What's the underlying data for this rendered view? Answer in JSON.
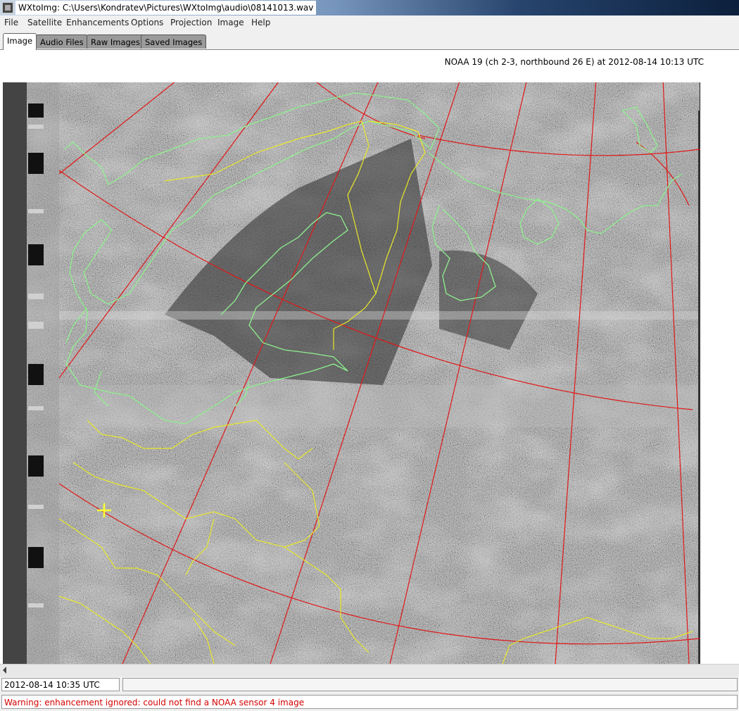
{
  "window": {
    "title": "WXtoImg: C:\\Users\\Kondratev\\Pictures\\WXtoImg\\audio\\08141013.wav"
  },
  "menu": [
    "File",
    "Satellite",
    "Enhancements",
    "Options",
    "Projection",
    "Image",
    "Help"
  ],
  "tabs": [
    "Image",
    "Audio Files",
    "Raw Images",
    "Saved Images"
  ],
  "image_info": "NOAA 19 (ch 2-3, northbound 26 E) at 2012-08-14  10:13 UTC",
  "status": {
    "time": "2012-08-14  10:35 UTC",
    "warning": "Warning: enhancement ignored: could not find a NOAA sensor 4 image"
  },
  "colors": {
    "coastline": "#8ef08e",
    "borders": "#e8e82a",
    "grid": "#e01818",
    "warning": "#d40000"
  },
  "icons": [
    "app-icon",
    "scroll-left-arrow-icon",
    "marker-cross-icon"
  ]
}
